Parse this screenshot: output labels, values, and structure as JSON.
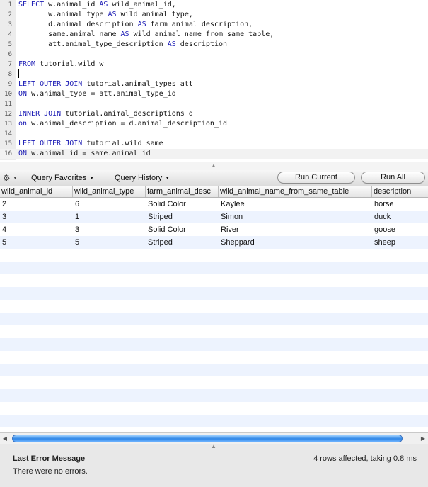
{
  "editor": {
    "lines": [
      {
        "n": "1",
        "tokens": [
          {
            "t": "SELECT",
            "kw": true
          },
          {
            "t": " w.animal_id "
          },
          {
            "t": "AS",
            "kw": true
          },
          {
            "t": " wild_animal_id,"
          }
        ]
      },
      {
        "n": "2",
        "tokens": [
          {
            "t": "       w.animal_type "
          },
          {
            "t": "AS",
            "kw": true
          },
          {
            "t": " wild_animal_type,"
          }
        ]
      },
      {
        "n": "3",
        "tokens": [
          {
            "t": "       d.animal_description "
          },
          {
            "t": "AS",
            "kw": true
          },
          {
            "t": " farm_animal_description,"
          }
        ]
      },
      {
        "n": "4",
        "tokens": [
          {
            "t": "       same.animal_name "
          },
          {
            "t": "AS",
            "kw": true
          },
          {
            "t": " wild_animal_name_from_same_table,"
          }
        ]
      },
      {
        "n": "5",
        "tokens": [
          {
            "t": "       att.animal_type_description "
          },
          {
            "t": "AS",
            "kw": true
          },
          {
            "t": " description"
          }
        ]
      },
      {
        "n": "6",
        "tokens": []
      },
      {
        "n": "7",
        "tokens": [
          {
            "t": "FROM",
            "kw": true
          },
          {
            "t": " tutorial.wild w"
          }
        ]
      },
      {
        "n": "8",
        "tokens": [],
        "caret": true
      },
      {
        "n": "9",
        "tokens": [
          {
            "t": "LEFT OUTER JOIN",
            "kw": true
          },
          {
            "t": " tutorial.animal_types att"
          }
        ]
      },
      {
        "n": "10",
        "tokens": [
          {
            "t": "ON",
            "kw": true
          },
          {
            "t": " w.animal_type = att.animal_type_id"
          }
        ]
      },
      {
        "n": "11",
        "tokens": []
      },
      {
        "n": "12",
        "tokens": [
          {
            "t": "INNER JOIN",
            "kw": true
          },
          {
            "t": " tutorial.animal_descriptions d"
          }
        ]
      },
      {
        "n": "13",
        "tokens": [
          {
            "t": "on",
            "kw": true
          },
          {
            "t": " w.animal_description = d.animal_description_id"
          }
        ]
      },
      {
        "n": "14",
        "tokens": []
      },
      {
        "n": "15",
        "tokens": [
          {
            "t": "LEFT OUTER JOIN",
            "kw": true
          },
          {
            "t": " tutorial.wild same"
          }
        ]
      },
      {
        "n": "16",
        "tokens": [
          {
            "t": "ON",
            "kw": true
          },
          {
            "t": " w.animal_id = same.animal_id"
          }
        ]
      }
    ]
  },
  "toolbar": {
    "gear_icon": "gear-icon",
    "query_favorites": "Query Favorites",
    "query_history": "Query History",
    "run_current": "Run Current",
    "run_all": "Run All"
  },
  "results": {
    "columns": [
      "wild_animal_id",
      "wild_animal_type",
      "farm_animal_desc",
      "wild_animal_name_from_same_table",
      "description"
    ],
    "rows": [
      [
        "2",
        "6",
        "Solid Color",
        "Kaylee",
        "horse"
      ],
      [
        "3",
        "1",
        "Striped",
        "Simon",
        "duck"
      ],
      [
        "4",
        "3",
        "Solid Color",
        "River",
        "goose"
      ],
      [
        "5",
        "5",
        "Striped",
        "Sheppard",
        "sheep"
      ]
    ]
  },
  "status": {
    "title": "Last Error Message",
    "message": "There were no errors.",
    "summary": "4 rows affected, taking 0.8 ms"
  },
  "colors": {
    "keyword": "#1a1ab4",
    "row_stripe": "#edf3fe",
    "scroll_thumb": "#2f86e6"
  }
}
